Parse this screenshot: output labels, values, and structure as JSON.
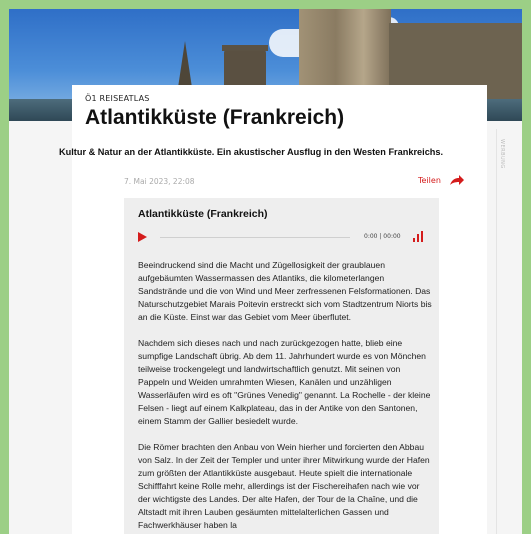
{
  "article": {
    "kicker": "Ö1 REISEATLAS",
    "title": "Atlantikküste (Frankreich)",
    "subtitle": "Kultur & Natur an der Atlantikküste. Ein akustischer Ausflug in den Westen Frankreichs.",
    "date": "7. Mai 2023, 22:08",
    "share_label": "Teilen"
  },
  "audio": {
    "title": "Atlantikküste (Frankreich)",
    "time": "0:00 | 00:00",
    "progress": 0
  },
  "body": {
    "paragraphs": [
      "Beeindruckend sind die Macht und Zügellosigkeit der graublauen aufgebäumten Wassermassen des Atlantiks, die kilometerlangen Sandstrände und die von Wind und Meer zerfressenen Felsformationen. Das Naturschutzgebiet Marais Poitevin erstreckt sich vom Stadtzentrum Niorts bis an die Küste. Einst war das Gebiet vom Meer überflutet.",
      "Nachdem sich dieses nach und nach zurückgezogen hatte, blieb eine sumpfige Landschaft übrig. Ab dem 11. Jahrhundert wurde es von Mönchen teilweise trockengelegt und landwirtschaftlich genutzt. Mit seinen von Pappeln und Weiden umrahmten Wiesen, Kanälen und unzähligen Wasserläufen wird es oft \"Grünes Venedig\" genannt. La Rochelle - der kleine Felsen - liegt auf einem Kalkplateau, das in der Antike von den Santonen, einem Stamm der Gallier besiedelt wurde.",
      "Die Römer brachten den Anbau von Wein hierher und forcierten den Abbau von Salz. In der Zeit der Templer und unter ihrer Mitwirkung wurde der Hafen zum größten der Atlantikküste ausgebaut. Heute spielt die internationale Schifffahrt keine Rolle mehr, allerdings ist der Fischereihafen nach wie vor der wichtigste des Landes. Der alte Hafen, der Tour de la Chaîne, und die Altstadt mit ihren Lauben gesäumten mittelalterlichen Gassen und Fachwerkhäuser haben la"
    ]
  },
  "sidebar": {
    "label": "WERBUNG"
  },
  "colors": {
    "accent": "#d41c1c",
    "background_frame": "#9ccf86"
  },
  "icons": {
    "share": "share-arrow-icon",
    "play": "play-icon",
    "volume": "volume-icon"
  }
}
